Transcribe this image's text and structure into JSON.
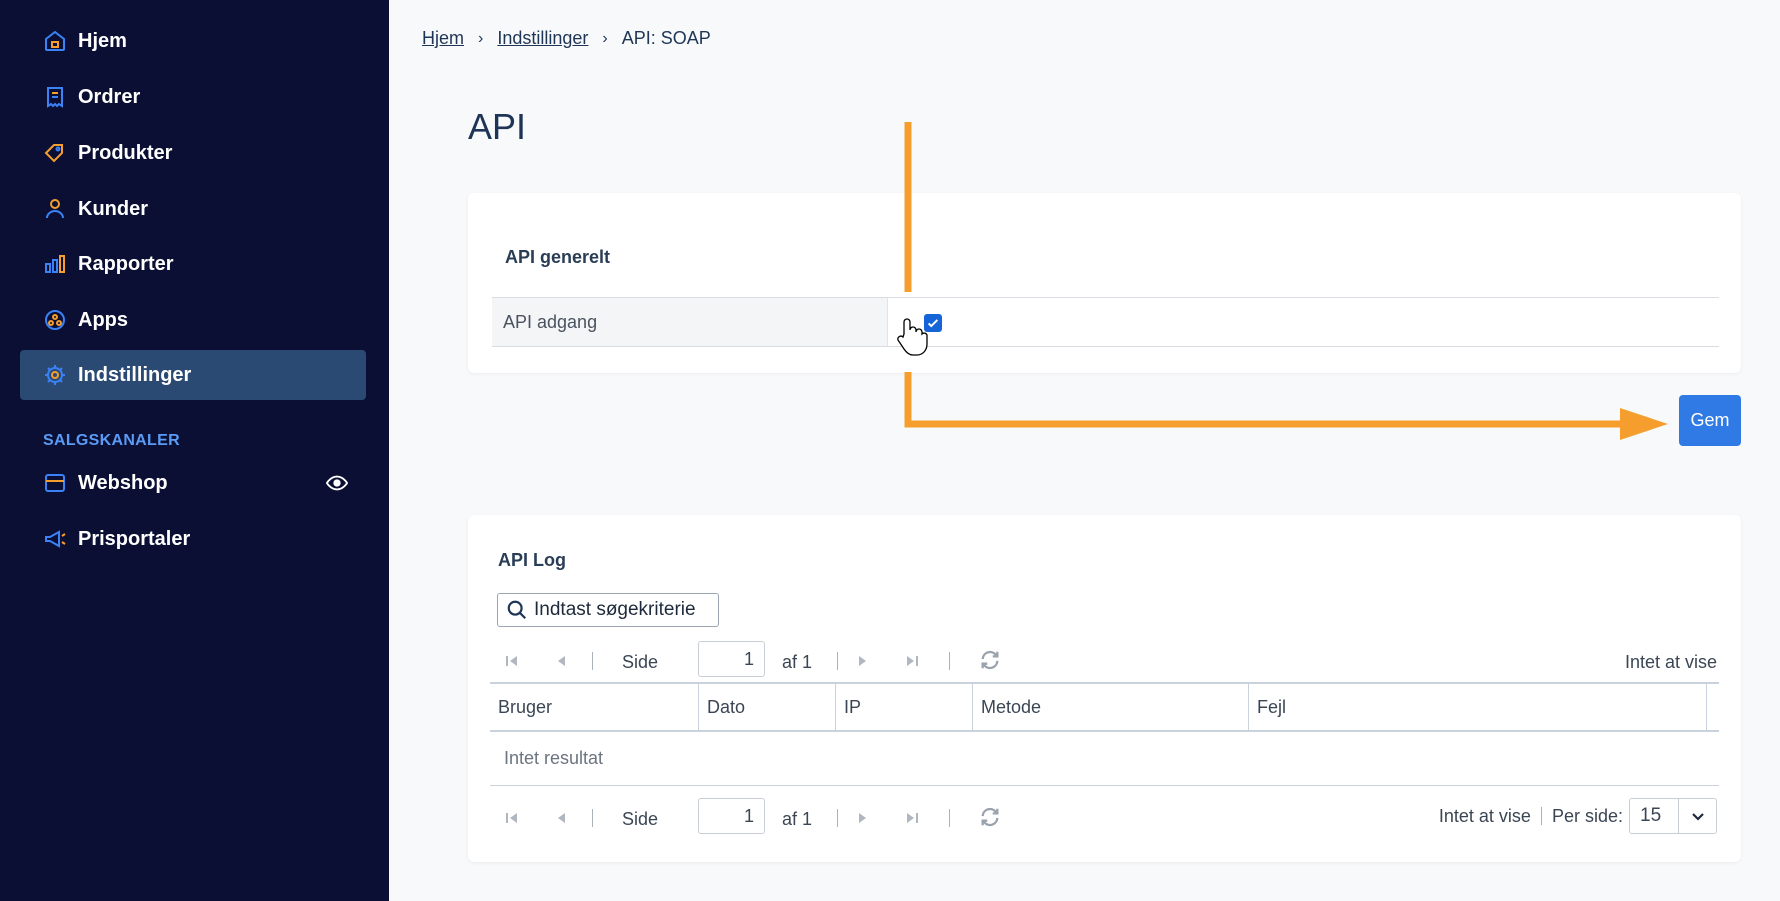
{
  "sidebar": {
    "items": [
      {
        "label": "Hjem",
        "icon": "home-icon"
      },
      {
        "label": "Ordrer",
        "icon": "receipt-icon"
      },
      {
        "label": "Produkter",
        "icon": "tag-icon"
      },
      {
        "label": "Kunder",
        "icon": "user-icon"
      },
      {
        "label": "Rapporter",
        "icon": "bar-chart-icon"
      },
      {
        "label": "Apps",
        "icon": "apps-icon"
      },
      {
        "label": "Indstillinger",
        "icon": "gear-icon",
        "active": true
      }
    ],
    "section_label": "SALGSKANALER",
    "channels": [
      {
        "label": "Webshop",
        "icon": "store-icon"
      },
      {
        "label": "Prisportaler",
        "icon": "megaphone-icon"
      }
    ]
  },
  "breadcrumb": {
    "home": "Hjem",
    "settings": "Indstillinger",
    "current": "API: SOAP"
  },
  "page_title": "API",
  "api_general": {
    "heading": "API generelt",
    "access_label": "API adgang",
    "access_checked": true
  },
  "save_label": "Gem",
  "api_log": {
    "heading": "API Log",
    "search_placeholder": "Indtast søgekriterie",
    "pager": {
      "page_label": "Side",
      "page_value": "1",
      "of_label": "af 1",
      "count_text": "Intet at vise",
      "per_page_label": "Per side:",
      "per_page_value": "15"
    },
    "columns": [
      "Bruger",
      "Dato",
      "IP",
      "Metode",
      "Fejl"
    ],
    "empty_text": "Intet resultat"
  },
  "colors": {
    "sidebar_bg": "#0a0f33",
    "active_item": "#2b4a73",
    "accent_orange": "#f59e2e",
    "primary_blue": "#2f7ae5"
  }
}
